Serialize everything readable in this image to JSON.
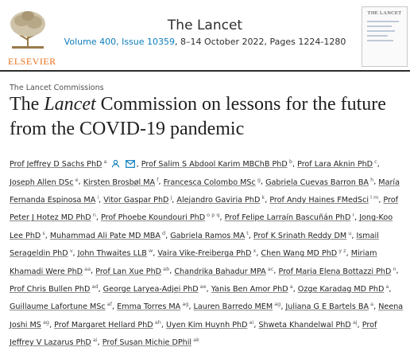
{
  "header": {
    "publisher": "ELSEVIER",
    "journal_title": "The Lancet",
    "volume_link": "Volume 400, Issue 10359",
    "date_pages": ", 8–14 October 2022, Pages 1224-1280",
    "cover_title": "THE LANCET"
  },
  "article": {
    "section": "The Lancet Commissions",
    "title_pre": "The ",
    "title_italic": "Lancet",
    "title_post": " Commission on lessons for the future from the COVID-19 pandemic"
  },
  "icons": {
    "person": "person-icon",
    "mail": "mail-icon"
  },
  "authors": [
    {
      "name": "Prof Jeffrey D Sachs PhD",
      "sup": "a"
    },
    {
      "name": "Prof Salim S Abdool Karim MBChB PhD",
      "sup": "b"
    },
    {
      "name": "Prof Lara Aknin PhD",
      "sup": "c"
    },
    {
      "name": "Joseph Allen DSc",
      "sup": "e"
    },
    {
      "name": "Kirsten Brosbøl MA",
      "sup": "f"
    },
    {
      "name": "Francesca Colombo MSc",
      "sup": "g"
    },
    {
      "name": "Gabriela Cuevas Barron BA",
      "sup": "h"
    },
    {
      "name": "María Fernanda Espinosa MA",
      "sup": "i"
    },
    {
      "name": "Vitor Gaspar PhD",
      "sup": "j"
    },
    {
      "name": "Alejandro Gaviria PhD",
      "sup": "k"
    },
    {
      "name": "Prof Andy Haines FMedSci",
      "sup": "l m"
    },
    {
      "name": "Prof Peter J Hotez MD PhD",
      "sup": "n"
    },
    {
      "name": "Prof Phoebe Koundouri PhD",
      "sup": "o p q"
    },
    {
      "name": "Prof Felipe Larraín Bascuñán PhD",
      "sup": "r"
    },
    {
      "name": "Jong-Koo Lee PhD",
      "sup": "s"
    },
    {
      "name": "Muhammad Ali Pate MD MBA",
      "sup": "d"
    },
    {
      "name": "Gabriela Ramos MA",
      "sup": "t"
    },
    {
      "name": "Prof K Srinath Reddy DM",
      "sup": "u"
    },
    {
      "name": "Ismail Serageldin PhD",
      "sup": "v"
    },
    {
      "name": "John Thwaites LLB",
      "sup": "w"
    },
    {
      "name": "Vaira Vike-Freiberga PhD",
      "sup": "x"
    },
    {
      "name": "Chen Wang MD PhD",
      "sup": "y z"
    },
    {
      "name": "Miriam Khamadi Were PhD",
      "sup": "aa"
    },
    {
      "name": "Prof Lan Xue PhD",
      "sup": "ab"
    },
    {
      "name": "Chandrika Bahadur MPA",
      "sup": "ac"
    },
    {
      "name": "Prof Maria Elena Bottazzi PhD",
      "sup": "n"
    },
    {
      "name": "Prof Chris Bullen PhD",
      "sup": "ad"
    },
    {
      "name": "George Laryea-Adjei PhD",
      "sup": "ae"
    },
    {
      "name": "Yanis Ben Amor PhD",
      "sup": "a"
    },
    {
      "name": "Ozge Karadag MD PhD",
      "sup": "a"
    },
    {
      "name": "Guillaume Lafortune MSc",
      "sup": "af"
    },
    {
      "name": "Emma Torres MA",
      "sup": "ag"
    },
    {
      "name": "Lauren Barredo MEM",
      "sup": "ag"
    },
    {
      "name": "Juliana G E Bartels BA",
      "sup": "a"
    },
    {
      "name": "Neena Joshi MS",
      "sup": "ag"
    },
    {
      "name": "Prof Margaret Hellard PhD",
      "sup": "ah"
    },
    {
      "name": "Uyen Kim Huynh PhD",
      "sup": "ai"
    },
    {
      "name": "Shweta Khandelwal PhD",
      "sup": "aj"
    },
    {
      "name": "Prof Jeffrey V Lazarus PhD",
      "sup": "ai"
    },
    {
      "name": "Prof Susan Michie DPhil",
      "sup": "ak"
    }
  ]
}
